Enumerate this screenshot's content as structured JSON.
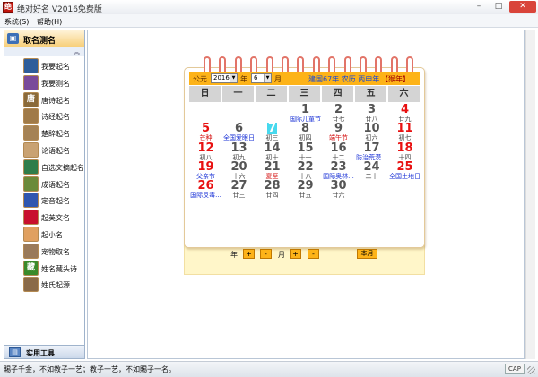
{
  "window": {
    "title": "绝对好名 V2016免费版",
    "app_icon": "绝"
  },
  "window_controls": {
    "minimize": "–",
    "maximize": "□",
    "close": "✕"
  },
  "menu": {
    "items": [
      "系统(S)",
      "帮助(H)"
    ]
  },
  "sidebar": {
    "header": {
      "icon": "person-card-icon",
      "label": "取名测名"
    },
    "scroll_up": "︽",
    "items": [
      {
        "label": "我要起名",
        "icon": "boy-avatar-icon",
        "color": "#2e5d9a"
      },
      {
        "label": "我要测名",
        "icon": "girl-avatar-icon",
        "color": "#7a4a9a"
      },
      {
        "label": "唐诗起名",
        "icon": "tang-seal-icon",
        "glyph": "唐",
        "color": "#8a6a3a"
      },
      {
        "label": "诗经起名",
        "icon": "scroll-painting-icon",
        "color": "#a07a48"
      },
      {
        "label": "楚辞起名",
        "icon": "scroll-painting-icon",
        "color": "#a58255"
      },
      {
        "label": "论语起名",
        "icon": "confucius-icon",
        "color": "#c9a272"
      },
      {
        "label": "自选文摘起名",
        "icon": "book-icon",
        "color": "#2f7d4a"
      },
      {
        "label": "成语起名",
        "icon": "book-stack-icon",
        "color": "#6b8a3a"
      },
      {
        "label": "定音起名",
        "icon": "blue-ball-icon",
        "color": "#2f56b0"
      },
      {
        "label": "起英文名",
        "icon": "uk-flag-icon",
        "color": "#c8102e"
      },
      {
        "label": "起小名",
        "icon": "baby-icon",
        "color": "#e0a060"
      },
      {
        "label": "宠物取名",
        "icon": "dog-icon",
        "color": "#9a7a5a"
      },
      {
        "label": "姓名藏头诗",
        "icon": "hidden-poem-icon",
        "glyph": "藏",
        "color": "#3a8a2a"
      },
      {
        "label": "姓氏起源",
        "icon": "surname-scroll-icon",
        "color": "#8a6a48"
      }
    ],
    "footer": {
      "icon": "toolbox-icon",
      "label": "实用工具"
    }
  },
  "calendar": {
    "header": {
      "era_label": "公元",
      "year_value": "2016",
      "year_unit": "年",
      "month_value": "6",
      "month_unit": "月",
      "lunar_info": "建国67年 农历 丙申年",
      "zodiac_tag": "【猴年】"
    },
    "weekdays": [
      "日",
      "一",
      "二",
      "三",
      "四",
      "五",
      "六"
    ],
    "weeks": [
      [
        null,
        null,
        null,
        {
          "day": "1",
          "lunar": "国际儿童节",
          "kind": "fest"
        },
        {
          "day": "2",
          "lunar": "廿七"
        },
        {
          "day": "3",
          "lunar": "廿八"
        },
        {
          "day": "4",
          "lunar": "廿九",
          "weekend": true
        }
      ],
      [
        {
          "day": "5",
          "lunar": "芒种",
          "kind": "term",
          "weekend": true
        },
        {
          "day": "6",
          "lunar": "全国爱眼日",
          "kind": "fest"
        },
        {
          "day": "7",
          "lunar": "初三",
          "today": true
        },
        {
          "day": "8",
          "lunar": "初四"
        },
        {
          "day": "9",
          "lunar": "端午节",
          "kind": "term"
        },
        {
          "day": "10",
          "lunar": "初六"
        },
        {
          "day": "11",
          "lunar": "初七",
          "weekend": true
        }
      ],
      [
        {
          "day": "12",
          "lunar": "初八",
          "weekend": true
        },
        {
          "day": "13",
          "lunar": "初九"
        },
        {
          "day": "14",
          "lunar": "初十"
        },
        {
          "day": "15",
          "lunar": "十一"
        },
        {
          "day": "16",
          "lunar": "十二"
        },
        {
          "day": "17",
          "lunar": "防治荒漠...",
          "kind": "fest"
        },
        {
          "day": "18",
          "lunar": "十四",
          "weekend": true
        }
      ],
      [
        {
          "day": "19",
          "lunar": "父亲节",
          "kind": "fest",
          "weekend": true
        },
        {
          "day": "20",
          "lunar": "十六"
        },
        {
          "day": "21",
          "lunar": "夏至",
          "kind": "term"
        },
        {
          "day": "22",
          "lunar": "十八"
        },
        {
          "day": "23",
          "lunar": "国际奥林...",
          "kind": "fest"
        },
        {
          "day": "24",
          "lunar": "二十"
        },
        {
          "day": "25",
          "lunar": "全国土地日",
          "kind": "fest",
          "weekend": true
        }
      ],
      [
        {
          "day": "26",
          "lunar": "国际反毒...",
          "kind": "fest",
          "weekend": true
        },
        {
          "day": "27",
          "lunar": "廿三"
        },
        {
          "day": "28",
          "lunar": "廿四"
        },
        {
          "day": "29",
          "lunar": "廿五"
        },
        {
          "day": "30",
          "lunar": "廿六"
        },
        null,
        null
      ]
    ],
    "nav": {
      "year_label": "年",
      "month_label": "月",
      "prev": "-",
      "next": "+",
      "current_month": "本月"
    }
  },
  "status": {
    "message": "賜子千金，不如教子一艺；教子一艺，不如賜子一名。",
    "caps_indicator": "CAP"
  },
  "colors": {
    "calendar_accent": "#fdb318",
    "weekend_red": "#e81010",
    "festival_blue": "#1830d6",
    "today_highlight": "#47d9ee"
  }
}
